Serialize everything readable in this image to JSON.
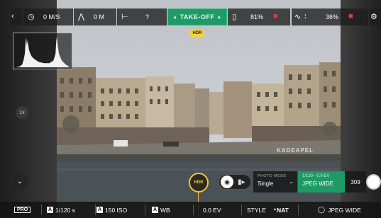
{
  "top_bar": {
    "back_icon": "chevron-left-icon",
    "speed_value": "0 M/S",
    "height_value": "0 M",
    "distance_value": "?",
    "takeoff_label": "TAKE-OFF",
    "drone_battery": "81%",
    "device_battery": "36%",
    "settings_icon": "gear-icon"
  },
  "hdr_badge": "HDR",
  "zoom_label": "1x",
  "bottom_controls": {
    "hdr_button": "HDR",
    "photo_mode_title": "PHOTO MODE",
    "photo_mode_value": "Single",
    "format_top": "1/120 - 0.0 EV",
    "format_value": "JPEG WIDE",
    "photo_count": "309"
  },
  "bottom_bar": {
    "pro_label": "PRO",
    "shutter_label": "1/120 s",
    "iso_label": "150 ISO",
    "wb_label": "WB",
    "ev_label": "0.0 EV",
    "style_label": "STYLE",
    "style_value": "NAT",
    "format_label": "JPEG WIDE",
    "auto_badge": "A"
  },
  "colors": {
    "accent_green": "#1f9a66",
    "hdr_yellow": "#f3c42e",
    "alert_red": "#e23a3a"
  }
}
